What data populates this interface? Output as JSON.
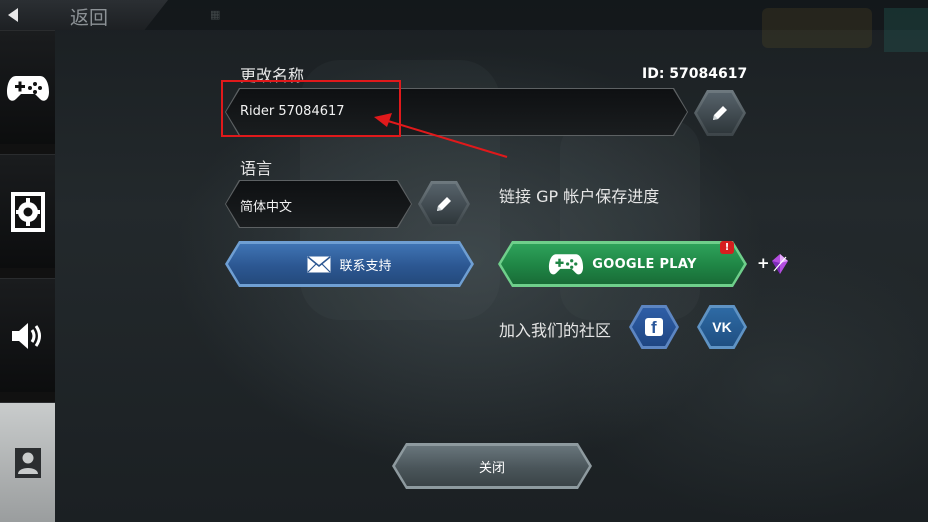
{
  "topbar": {
    "back_label": "返回"
  },
  "sidebar": {
    "items": [
      {
        "icon": "gamepad-icon"
      },
      {
        "icon": "settings-icon"
      },
      {
        "icon": "speaker-icon"
      },
      {
        "icon": "profile-icon",
        "active": true
      }
    ]
  },
  "name_section": {
    "label": "更改名称",
    "id_text": "ID: 57084617",
    "value": "Rider 57084617"
  },
  "language_section": {
    "label": "语言",
    "value": "简体中文"
  },
  "link_gp": {
    "text": "链接 GP 帐户保存进度"
  },
  "support_button": {
    "label": "联系支持",
    "icon": "mail-icon"
  },
  "google_play_button": {
    "label": "GOOGLE PLAY",
    "badge": "!",
    "reward_prefix": "+",
    "icon": "gamepad-icon"
  },
  "community": {
    "label": "加入我们的社区",
    "facebook": "f",
    "vk": "VK"
  },
  "close_button": {
    "label": "关闭"
  },
  "colors": {
    "annotation_red": "#e0191b",
    "support_blue": "#2c5792",
    "play_green": "#1f8545"
  }
}
